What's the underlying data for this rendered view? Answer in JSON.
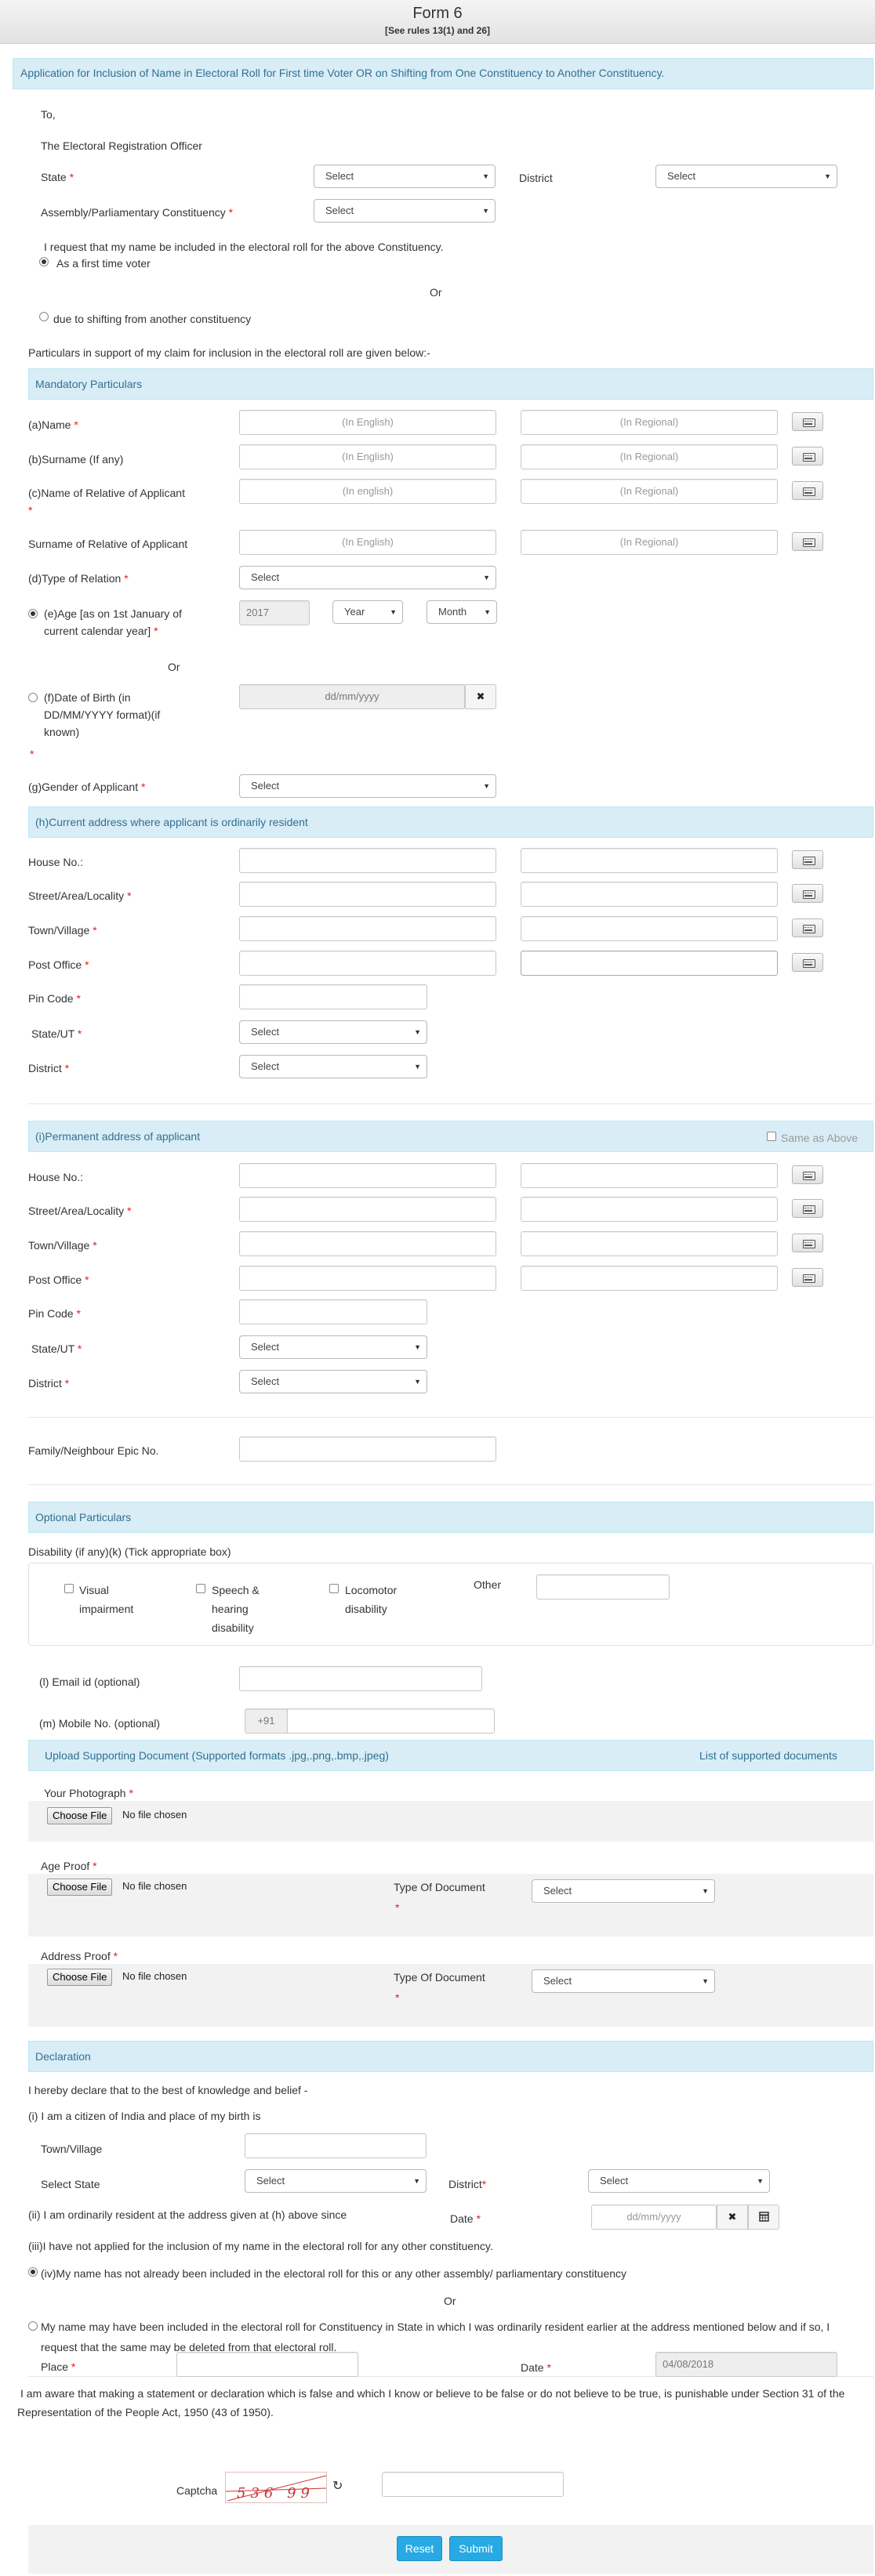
{
  "header": {
    "title": "Form 6",
    "subtitle": "[See rules 13(1) and 26]"
  },
  "intro": {
    "banner": "Application for Inclusion of Name in Electoral Roll for First time Voter OR on Shifting from One Constituency to Another Constituency.",
    "to": "To,",
    "officer": "The Electoral Registration Officer",
    "state_label": "State",
    "district_label": "District",
    "constituency_label": "Assembly/Parliamentary Constituency",
    "select": "Select",
    "request": "I request that my name be included in the electoral roll for the above Constituency.",
    "first_time": "As a first time voter",
    "or": "Or",
    "shifting": "due to shifting from another constituency",
    "particulars": "Particulars in support of my claim for inclusion in the electoral roll are given below:-"
  },
  "mandatory": {
    "heading": "Mandatory Particulars",
    "name": "(a)Name",
    "surname": "(b)Surname (If any)",
    "relative_name": "(c)Name of Relative of Applicant",
    "relative_surname": "Surname of Relative of Applicant",
    "relation_type": "(d)Type of Relation",
    "age": "(e)Age [as on 1st January of current calendar year]",
    "dob": "(f)Date of Birth (in DD/MM/YYYY format)(if known)",
    "gender": "(g)Gender of Applicant",
    "ph_english": "(In English)",
    "ph_english_lower": "(In english)",
    "ph_regional": "(In Regional)",
    "age_year_value": "2017",
    "year": "Year",
    "month": "Month",
    "dob_placeholder": "dd/mm/yyyy",
    "clear": "✖"
  },
  "current_address": {
    "heading": "(h)Current address where applicant is ordinarily resident",
    "house": "House No.:",
    "street": "Street/Area/Locality",
    "town": "Town/Village",
    "post": "Post Office",
    "pin": "Pin Code",
    "state": "State/UT",
    "district": "District"
  },
  "permanent_address": {
    "heading": "(i)Permanent address of applicant",
    "same": "Same as Above",
    "house": "House No.:",
    "street": "Street/Area/Locality",
    "town": "Town/Village",
    "post": "Post Office",
    "pin": "Pin Code",
    "state": "State/UT",
    "district": "District"
  },
  "epic": {
    "label": "Family/Neighbour Epic No."
  },
  "optional": {
    "heading": "Optional Particulars",
    "disability": "Disability (if any)(k) (Tick appropriate box)",
    "visual": "Visual impairment",
    "speech": "Speech & hearing disability",
    "locomotor": "Locomotor disability",
    "other": "Other",
    "email": "(l) Email id (optional)",
    "mobile": "(m) Mobile No. (optional)",
    "prefix": "+91"
  },
  "upload": {
    "heading": "Upload Supporting Document (Supported formats .jpg,.png,.bmp,.jpeg)",
    "list_link": "List of supported documents",
    "photo": "Your Photograph",
    "age_proof": "Age Proof",
    "address_proof": "Address Proof",
    "choose": "Choose File",
    "nofile": "No file chosen",
    "doc_type": "Type Of Document"
  },
  "declaration": {
    "heading": "Declaration",
    "intro": "I hereby declare that to the best of knowledge and belief -",
    "citizen": "(i) I am a citizen of India and place of my birth is",
    "town": "Town/Village",
    "select_state": "Select State",
    "district": "District",
    "resident": "(ii) I am ordinarily resident at the address given at (h) above since",
    "date": "Date",
    "date_placeholder": "dd/mm/yyyy",
    "not_applied": "(iii)I have not applied for the inclusion of my name in the electoral roll for any other constituency.",
    "not_included": "(iv)My name has not already been included in the electoral roll for this or any other assembly/ parliamentary constituency",
    "or": "Or",
    "may_have": "My name may have been included in the electoral roll for Constituency in State in which I was ordinarily resident earlier at the address mentioned below and if so, I request that the same may be deleted from that electoral roll.",
    "place": "Place",
    "date_value": "04/08/2018",
    "aware": "I am aware that making a statement or declaration which is false and which I know or believe to be false or do not believe to be true, is punishable under Section 31 of the Representation of the People Act, 1950 (43 of 1950).",
    "captcha_label": "Captcha",
    "captcha_text": "536 99",
    "reset": "Reset",
    "submit": "Submit"
  },
  "colors": {
    "section_bg": "#d9edf7",
    "section_text": "#31708f",
    "required": "#e02020",
    "button": "#27a9e3"
  }
}
